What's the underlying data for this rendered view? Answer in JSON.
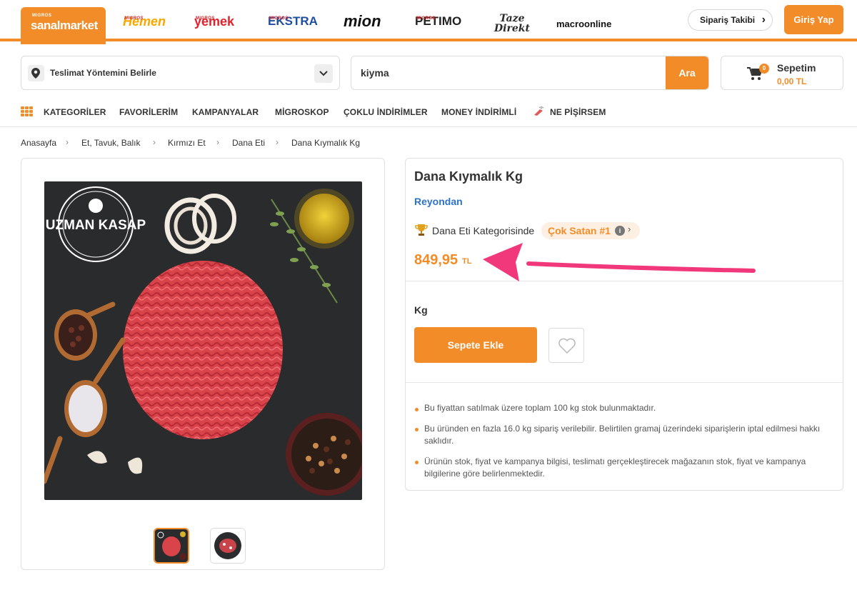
{
  "brands": {
    "sanalmarket": {
      "prefix": "MIGROS",
      "name": "sanalmarket"
    },
    "hemen": {
      "prefix": "MIGROS",
      "name": "Hemen"
    },
    "yemek": {
      "prefix": "MIGROS",
      "name": "yemek"
    },
    "ekstra": {
      "prefix": "MIGROS",
      "name": "EKSTRA"
    },
    "mion": {
      "name": "mion"
    },
    "petimo": {
      "prefix": "MIGROS",
      "name": "PETIMO"
    },
    "taze": {
      "name": "Taze Direkt"
    },
    "macro": {
      "name": "macroonline"
    }
  },
  "header": {
    "order_tracking": "Sipariş Takibi",
    "login": "Giriş Yap"
  },
  "search_row": {
    "delivery_label": "Teslimat Yöntemini Belirle",
    "search_value": "kiyma",
    "search_button": "Ara",
    "cart_title": "Sepetim",
    "cart_total": "0,00 TL",
    "cart_count": "0"
  },
  "nav": {
    "items": [
      "KATEGORİLER",
      "FAVORİLERİM",
      "KAMPANYALAR",
      "MİGROSKOP",
      "ÇOKLU İNDİRİMLER",
      "MONEY İNDİRİMLİ",
      "NE PİŞİRSEM"
    ]
  },
  "breadcrumb": [
    "Anasayfa",
    "Et, Tavuk, Balık",
    "Kırmızı Et",
    "Dana Eti",
    "Dana Kıymalık Kg"
  ],
  "product": {
    "logo_text": "UZMAN KASAP",
    "title": "Dana Kıymalık Kg",
    "brand": "Reyondan",
    "category_text": "Dana Eti Kategorisinde",
    "best_seller": "Çok Satan #1",
    "price": "849,95",
    "currency": "TL",
    "unit": "Kg",
    "add_to_cart": "Sepete Ekle",
    "notes": [
      "Bu fiyattan satılmak üzere toplam 100 kg stok bulunmaktadır.",
      "Bu üründen en fazla 16.0 kg sipariş verilebilir. Belirtilen gramaj üzerindeki siparişlerin iptal edilmesi hakkı saklıdır.",
      "Ürünün stok, fiyat ve kampanya bilgisi, teslimatı gerçekleştirecek mağazanın stok, fiyat ve kampanya bilgilerine göre belirlenmektedir."
    ]
  },
  "colors": {
    "accent": "#f28c28",
    "link": "#2d73c8",
    "annotation_arrow": "#f0387a"
  },
  "icons": [
    "location-pin-icon",
    "chevron-down-icon",
    "cart-icon",
    "grid-icon",
    "chef-icon",
    "chevron-right-icon",
    "trophy-icon",
    "info-icon",
    "heart-icon"
  ]
}
